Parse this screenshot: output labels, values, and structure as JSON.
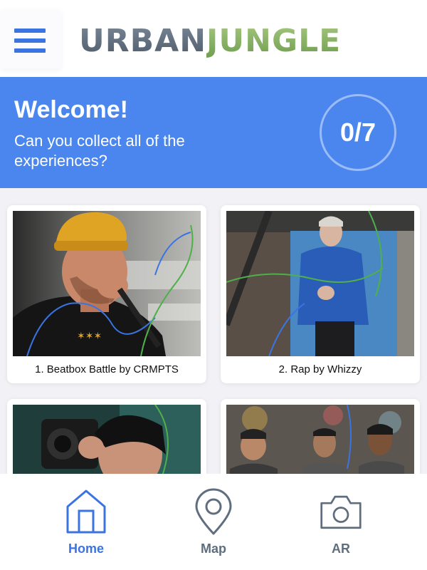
{
  "header": {
    "logo_part1": "URBAN",
    "logo_part2": "JUNGLE",
    "menu_icon": "hamburger-menu-icon"
  },
  "banner": {
    "title": "Welcome!",
    "subtitle": "Can you collect all of the experiences?",
    "progress": "0/7",
    "progress_collected": 0,
    "progress_total": 7
  },
  "experiences": [
    {
      "caption": "1. Beatbox Battle by CRMPTS"
    },
    {
      "caption": "2. Rap by Whizzy"
    },
    {
      "caption": ""
    },
    {
      "caption": ""
    }
  ],
  "nav": {
    "items": [
      {
        "label": "Home",
        "icon": "home-icon",
        "active": true
      },
      {
        "label": "Map",
        "icon": "map-pin-icon",
        "active": false
      },
      {
        "label": "AR",
        "icon": "camera-icon",
        "active": false
      }
    ]
  },
  "colors": {
    "accent": "#3b74e0",
    "banner": "#4a86ee",
    "logo_urban": "#5d6b7c",
    "logo_jungle": "#8fb66a",
    "nav_inactive": "#5f6e7e"
  }
}
